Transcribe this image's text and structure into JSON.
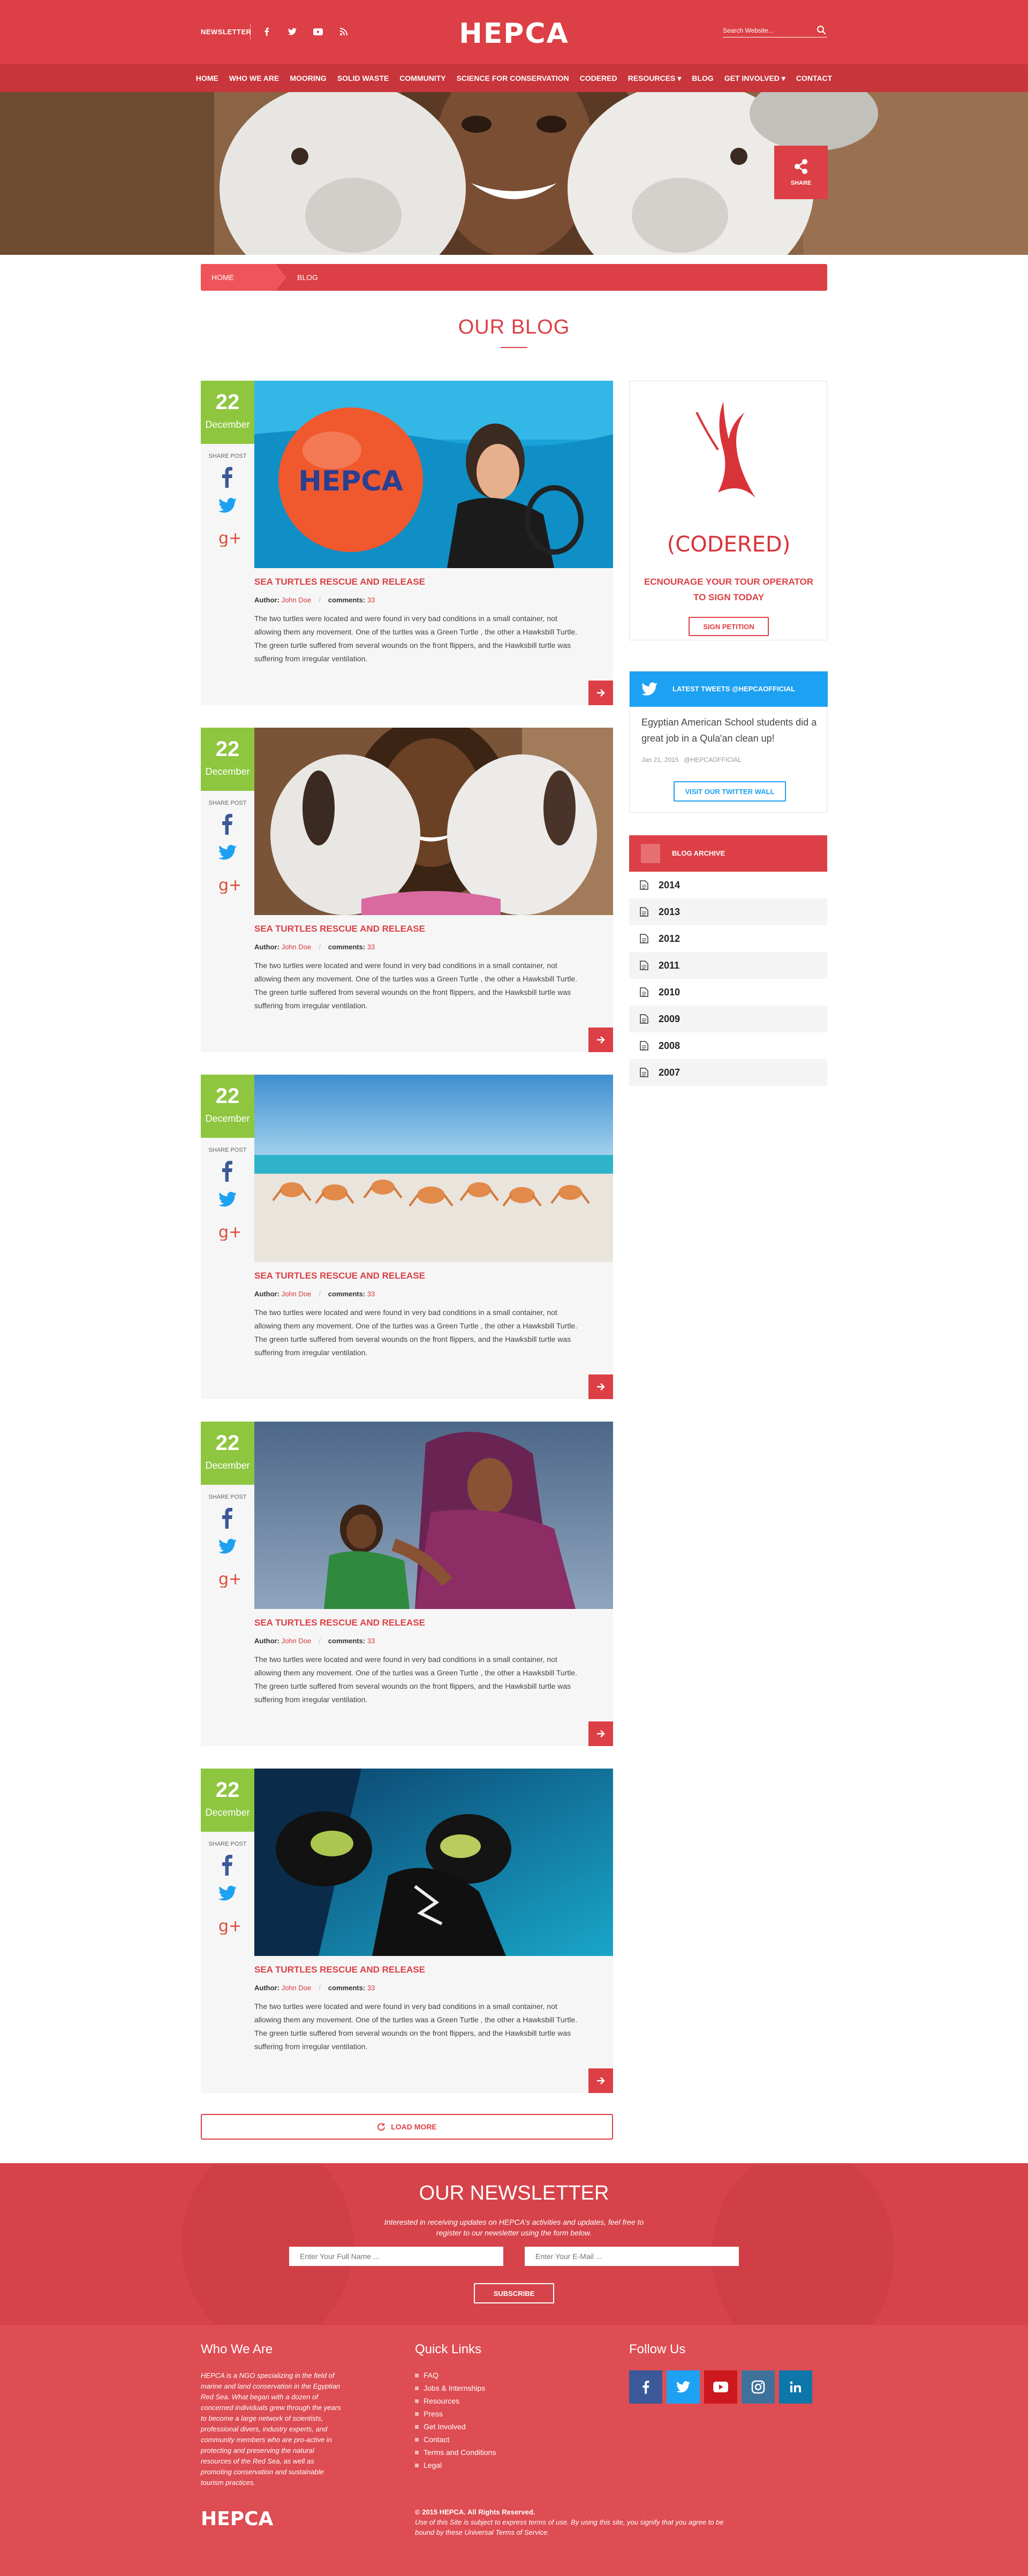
{
  "header": {
    "newsletter_link": "NEWSLETTER",
    "search_placeholder": "Search Website...",
    "logo_text": "HEPCA"
  },
  "nav": {
    "items": [
      "Home",
      "Who we are",
      "Mooring",
      "Solid Waste",
      "Community",
      "Science for Conservation",
      "CODERED",
      "Resources ▾",
      "Blog",
      "Get Involved ▾",
      "Contact"
    ]
  },
  "hero": {
    "share_label": "SHARE"
  },
  "breadcrumb": {
    "home": "HOME",
    "current": "BLOG"
  },
  "page_title": "OUR BLOG",
  "posts": [
    {
      "day": "22",
      "month": "December",
      "share_label": "SHARE POST",
      "title": "SEA TURTLES RESCUE AND RELEASE",
      "author_label": "Author:",
      "author": "John Doe",
      "comments_label": "comments:",
      "comments": "33",
      "excerpt": "The two turtles were located and were found in very bad conditions in a small container, not allowing them any movement. One of the turtles was a Green Turtle , the other a Hawksbill Turtle. The green turtle suffered from several wounds on the front flippers, and the Hawksbill turtle was suffering from irregular ventilation.",
      "buoy_text": "HEPCA"
    },
    {
      "day": "22",
      "month": "December",
      "share_label": "SHARE POST",
      "title": "SEA TURTLES RESCUE AND RELEASE",
      "author_label": "Author:",
      "author": "John Doe",
      "comments_label": "comments:",
      "comments": "33",
      "excerpt": "The two turtles were located and were found in very bad conditions in a small container, not allowing them any movement. One of the turtles was a Green Turtle , the other a Hawksbill Turtle. The green turtle suffered from several wounds on the front flippers, and the Hawksbill turtle was suffering from irregular ventilation."
    },
    {
      "day": "22",
      "month": "December",
      "share_label": "SHARE POST",
      "title": "SEA TURTLES RESCUE AND RELEASE",
      "author_label": "Author:",
      "author": "John Doe",
      "comments_label": "comments:",
      "comments": "33",
      "excerpt": "The two turtles were located and were found in very bad conditions in a small container, not allowing them any movement. One of the turtles was a Green Turtle , the other a Hawksbill Turtle. The green turtle suffered from several wounds on the front flippers, and the Hawksbill turtle was suffering from irregular ventilation."
    },
    {
      "day": "22",
      "month": "December",
      "share_label": "SHARE POST",
      "title": "SEA TURTLES RESCUE AND RELEASE",
      "author_label": "Author:",
      "author": "John Doe",
      "comments_label": "comments:",
      "comments": "33",
      "excerpt": "The two turtles were located and were found in very bad conditions in a small container, not allowing them any movement. One of the turtles was a Green Turtle , the other a Hawksbill Turtle. The green turtle suffered from several wounds on the front flippers, and the Hawksbill turtle was suffering from irregular ventilation."
    },
    {
      "day": "22",
      "month": "December",
      "share_label": "SHARE POST",
      "title": "SEA TURTLES RESCUE AND RELEASE",
      "author_label": "Author:",
      "author": "John Doe",
      "comments_label": "comments:",
      "comments": "33",
      "excerpt": "The two turtles were located and were found in very bad conditions in a small container, not allowing them any movement. One of the turtles was a Green Turtle , the other a Hawksbill Turtle. The green turtle suffered from several wounds on the front flippers, and the Hawksbill turtle was suffering from irregular ventilation."
    }
  ],
  "load_more": "LOAD MORE",
  "sidebar": {
    "codered": {
      "logo_text": "(CODERED)",
      "heading": "ECNOURAGE YOUR TOUR OPERATOR TO SIGN TODAY",
      "button": "SIGN PETITION"
    },
    "twitter": {
      "title": "LATEST TWEETS @HEPCAOFFICIAL",
      "tweet": "Egyptian American School students did a great job in a Qula'an clean up!",
      "date": "Jan 21, 2015",
      "handle": "@HEPCAOFFICIAL",
      "button": "VISIT OUR TWITTER WALL"
    },
    "archive": {
      "title": "BLOG ARCHIVE",
      "years": [
        "2014",
        "2013",
        "2012",
        "2011",
        "2010",
        "2009",
        "2008",
        "2007"
      ]
    }
  },
  "newsletter": {
    "title": "OUR NEWSLETTER",
    "description": "Interested in receiving updates on HEPCA's activities and updates, feel free to register to our newsletter using the form below.",
    "name_placeholder": "Enter Your Full Name ...",
    "email_placeholder": "Enter Your E-Mail ...",
    "button": "SUBSCRIBE"
  },
  "footer": {
    "who_title": "Who We Are",
    "who_text": "HEPCA is a NGO specializing in the field of marine and land conservation in the Egyptian Red Sea. What began with a dozen of concerned individuals grew through the years to become a large network of scientists, professional divers, industry experts, and community members who are pro-active in protecting and preserving the natural resources of the Red Sea, as well as promoting conservation and sustainable tourism practices.",
    "links_title": "Quick Links",
    "links": [
      "FAQ",
      "Jobs & Internships",
      "Resources",
      "Press",
      "Get Involved",
      "Contact",
      "Terms and Conditions",
      "Legal"
    ],
    "follow_title": "Follow Us",
    "copyright": "© 2015 HEPCA. All Rights Reserved.",
    "terms": "Use of this Site is subject to express terms of use. By using this site, you signify that you agree to be bound by these Universal Terms of Service."
  },
  "colors": {
    "brand_red": "#dc3f45",
    "date_green": "#8ec63f",
    "twitter_blue": "#1da1f2"
  }
}
